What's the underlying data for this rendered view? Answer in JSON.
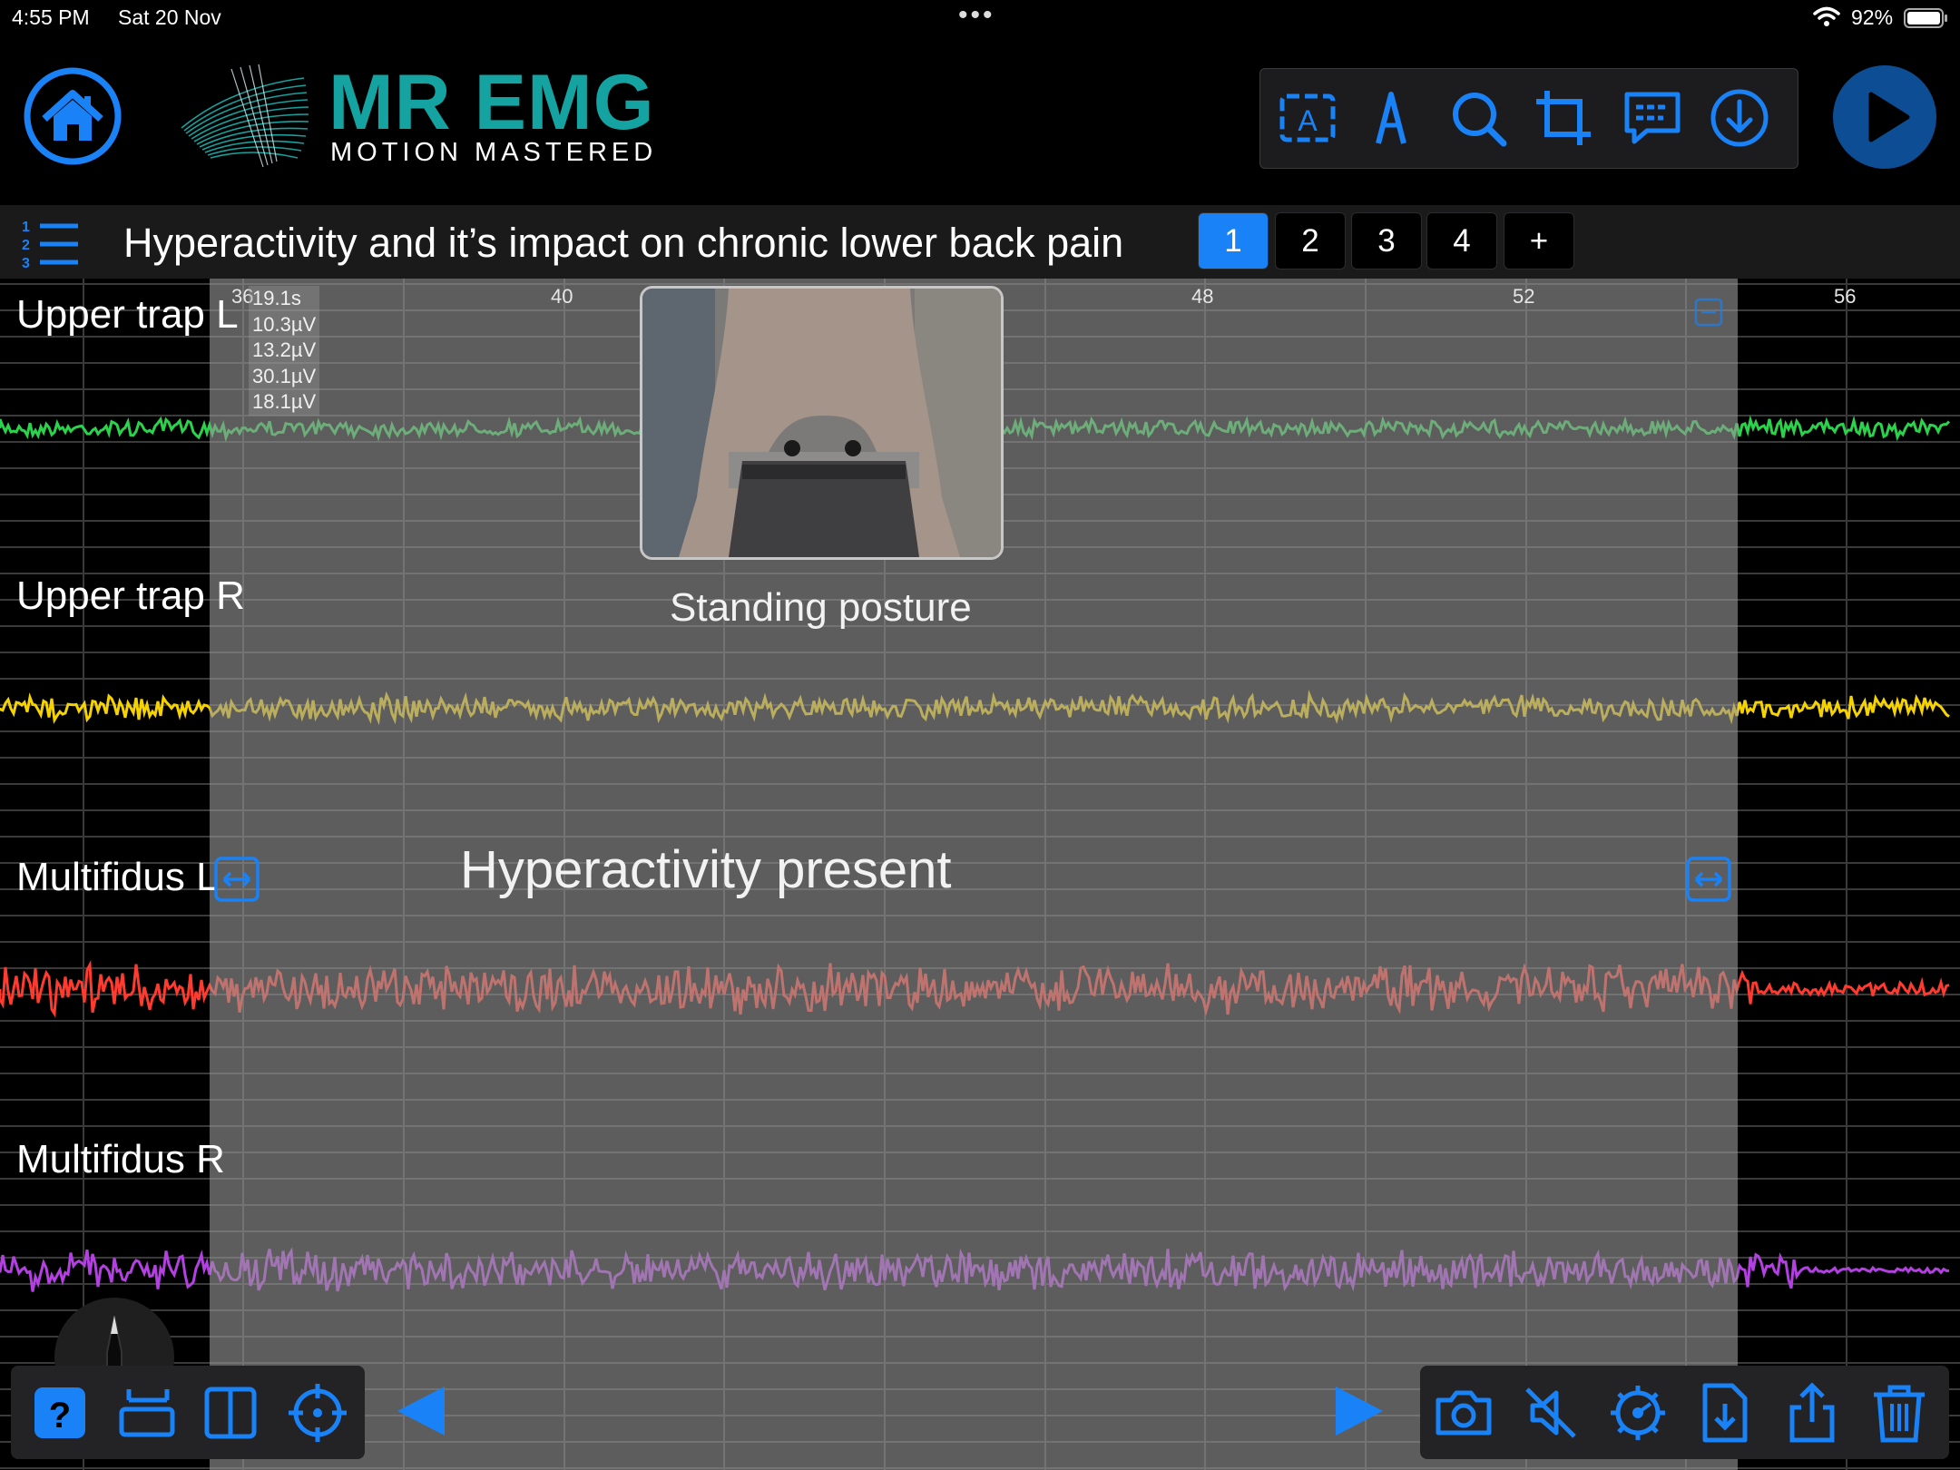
{
  "status": {
    "time": "4:55 PM",
    "date": "Sat 20 Nov",
    "more": "•••",
    "battery": "92%"
  },
  "brand": {
    "title": "MR EMG",
    "subtitle": "MOTION MASTERED",
    "color": "#14a3a0"
  },
  "toolbar": {
    "items": [
      "text-box-icon",
      "pen-icon",
      "search-icon",
      "crop-icon",
      "comment-icon",
      "download-icon"
    ],
    "accent": "#1a82f7"
  },
  "document": {
    "title": "Hyperactivity and it’s impact on chronic lower back pain",
    "pages": [
      "1",
      "2",
      "3",
      "4",
      "+"
    ],
    "active_page": "1"
  },
  "chart": {
    "x_ticks": [
      "36",
      "40",
      "48",
      "52",
      "56"
    ],
    "readout": {
      "time": "19.1s",
      "values": [
        "10.3µV",
        "13.2µV",
        "30.1µV",
        "18.1µV"
      ]
    },
    "photo_caption": "Standing posture",
    "annotation": "Hyperactivity present",
    "channels": [
      {
        "name": "Upper trap L",
        "color": "#2bd24b"
      },
      {
        "name": "Upper trap R",
        "color": "#f5d300"
      },
      {
        "name": "Multifidus L",
        "color": "#ff3b30"
      },
      {
        "name": "Multifidus  R",
        "color": "#b340e0"
      }
    ]
  },
  "pencil": {
    "level": "97"
  },
  "bottom_toolbar_left": [
    "help-icon",
    "stack-icon",
    "split-view-icon",
    "crosshair-icon"
  ],
  "bottom_toolbar_right": [
    "camera-icon",
    "mute-icon",
    "settings-icon",
    "file-download-icon",
    "share-icon",
    "trash-icon"
  ]
}
